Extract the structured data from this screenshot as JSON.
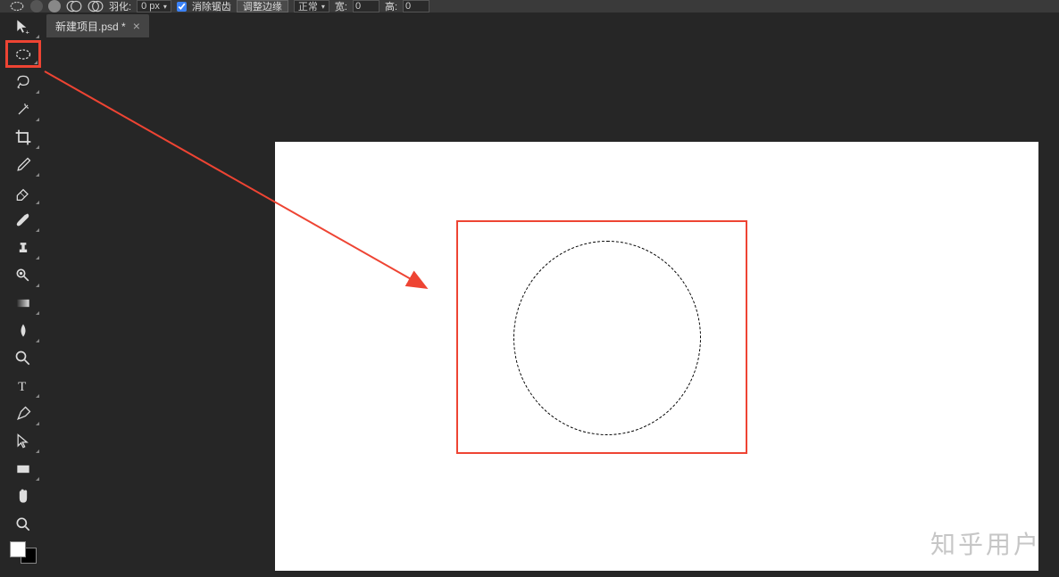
{
  "optionsBar": {
    "featherLabel": "羽化:",
    "featherValue": "0 px",
    "antiAliasLabel": "消除锯齿",
    "antiAliasChecked": true,
    "refineEdgeLabel": "调整边缘",
    "modeLabel": "正常",
    "widthLabel": "宽:",
    "widthValue": "0",
    "heightLabel": "高:",
    "heightValue": "0"
  },
  "tab": {
    "title": "新建项目.psd *"
  },
  "tools": [
    {
      "name": "move-tool",
      "hasCorner": true
    },
    {
      "name": "elliptical-marquee-tool",
      "selected": true,
      "hasCorner": true
    },
    {
      "name": "lasso-tool",
      "hasCorner": true
    },
    {
      "name": "magic-wand-tool",
      "hasCorner": true
    },
    {
      "name": "crop-tool",
      "hasCorner": true
    },
    {
      "name": "eyedropper-tool",
      "hasCorner": true
    },
    {
      "name": "eraser-tool",
      "hasCorner": true
    },
    {
      "name": "brush-tool",
      "hasCorner": true
    },
    {
      "name": "clone-stamp-tool",
      "hasCorner": true
    },
    {
      "name": "dodge-tool",
      "hasCorner": true
    },
    {
      "name": "gradient-tool",
      "hasCorner": true
    },
    {
      "name": "blur-tool",
      "hasCorner": true
    },
    {
      "name": "smudge-tool",
      "hasCorner": false
    },
    {
      "name": "text-tool",
      "hasCorner": true
    },
    {
      "name": "pen-tool",
      "hasCorner": true
    },
    {
      "name": "path-selection-tool",
      "hasCorner": true
    },
    {
      "name": "rectangle-tool",
      "hasCorner": true
    },
    {
      "name": "hand-tool",
      "hasCorner": false
    },
    {
      "name": "zoom-tool",
      "hasCorner": false
    }
  ],
  "colors": {
    "foreground": "#ffffff",
    "background": "#000000"
  },
  "watermark": "知乎用户",
  "annotation": {
    "highlightedTool": "elliptical-marquee-tool",
    "selectionShape": "ellipse"
  }
}
